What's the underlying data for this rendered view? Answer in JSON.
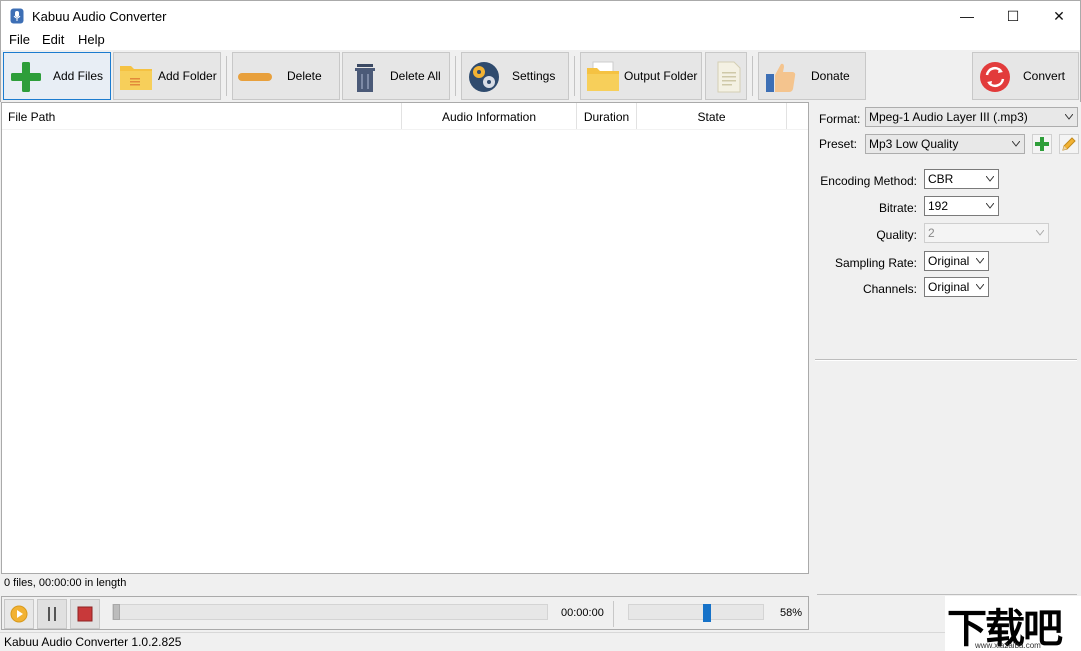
{
  "window": {
    "title": "Kabuu Audio Converter",
    "minimize_glyph": "—",
    "maximize_glyph": "☐",
    "close_glyph": "✕"
  },
  "menu": [
    "File",
    "Edit",
    "Help"
  ],
  "toolbar": {
    "add_files": "Add Files",
    "add_folder": "Add Folder",
    "delete": "Delete",
    "delete_all": "Delete All",
    "settings": "Settings",
    "output_folder": "Output Folder",
    "donate": "Donate",
    "convert": "Convert"
  },
  "file_list": {
    "columns": [
      "File Path",
      "Audio Information",
      "Duration",
      "State"
    ],
    "rows": []
  },
  "summary": "0 files, 00:00:00 in length",
  "player": {
    "time": "00:00:00",
    "volume_percent": "58%",
    "volume_fraction": 0.58,
    "seek_fraction": 0
  },
  "status": "Kabuu Audio Converter 1.0.2.825",
  "settings": {
    "format_label": "Format:",
    "format_value": "Mpeg-1 Audio Layer III (.mp3)",
    "preset_label": "Preset:",
    "preset_value": "Mp3 Low Quality",
    "encoding_label": "Encoding Method:",
    "encoding_value": "CBR",
    "bitrate_label": "Bitrate:",
    "bitrate_value": "192",
    "quality_label": "Quality:",
    "quality_value": "2",
    "sampling_label": "Sampling Rate:",
    "sampling_value": "Original",
    "channels_label": "Channels:",
    "channels_value": "Original"
  },
  "watermark": {
    "logo": "下载吧",
    "url": "www.xiazaiba.com"
  },
  "colors": {
    "accent": "#1672c8",
    "add_green": "#2e9e3a",
    "folder_yellow": "#f5c242",
    "delete_orange": "#e8a03c",
    "convert_red": "#e23b3b"
  }
}
